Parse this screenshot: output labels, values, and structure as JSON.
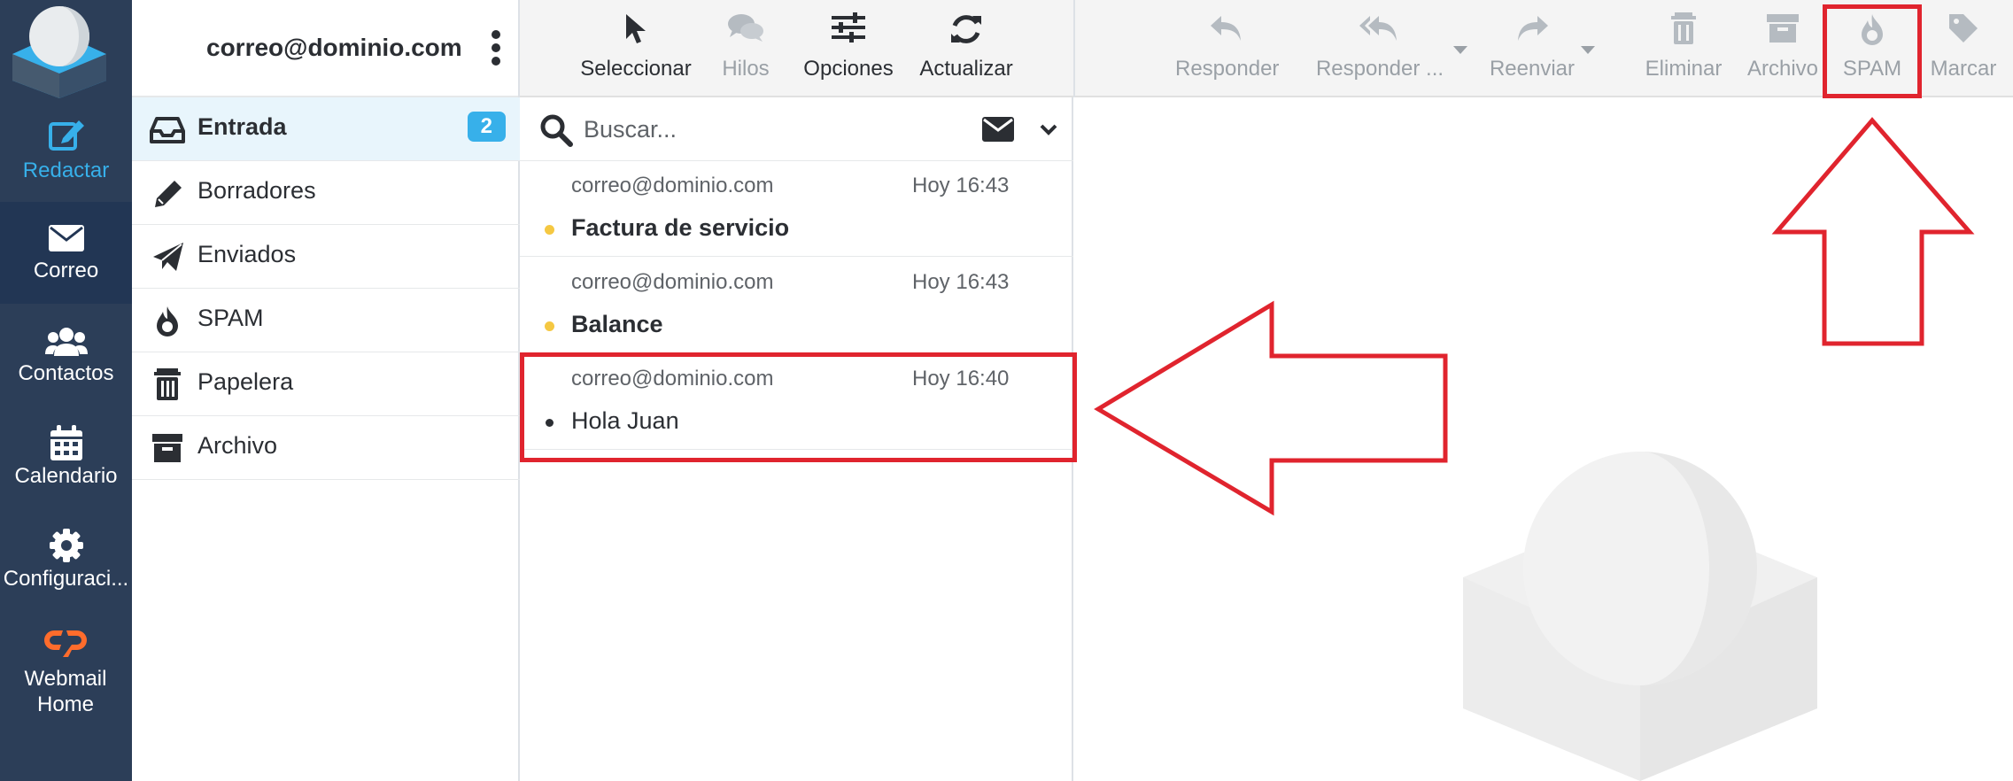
{
  "nav": [
    {
      "label": "Redactar",
      "icon": "compose-icon"
    },
    {
      "label": "Correo",
      "icon": "envelope-icon"
    },
    {
      "label": "Contactos",
      "icon": "users-icon"
    },
    {
      "label": "Calendario",
      "icon": "calendar-icon"
    },
    {
      "label": "Configuraci...",
      "icon": "gear-icon"
    },
    {
      "label": "Webmail Home",
      "icon": "cpanel-icon"
    }
  ],
  "account": "correo@dominio.com",
  "folders": [
    {
      "name": "Entrada",
      "icon": "inbox-icon",
      "badge": "2"
    },
    {
      "name": "Borradores",
      "icon": "pencil-icon"
    },
    {
      "name": "Enviados",
      "icon": "paper-plane-icon"
    },
    {
      "name": "SPAM",
      "icon": "fire-icon"
    },
    {
      "name": "Papelera",
      "icon": "trash-icon"
    },
    {
      "name": "Archivo",
      "icon": "archive-box-icon"
    }
  ],
  "toolbar": {
    "select": "Seleccionar",
    "threads": "Hilos",
    "options": "Opciones",
    "refresh": "Actualizar",
    "reply": "Responder",
    "reply_all": "Responder ...",
    "forward": "Reenviar",
    "delete": "Eliminar",
    "archive": "Archivo",
    "spam": "SPAM",
    "mark": "Marcar"
  },
  "search": {
    "placeholder": "Buscar..."
  },
  "messages": [
    {
      "from": "correo@dominio.com",
      "date": "Hoy 16:43",
      "subject": "Factura de servicio",
      "unread": true
    },
    {
      "from": "correo@dominio.com",
      "date": "Hoy 16:43",
      "subject": "Balance",
      "unread": true
    },
    {
      "from": "correo@dominio.com",
      "date": "Hoy 16:40",
      "subject": "Hola Juan",
      "unread": false
    }
  ],
  "colors": {
    "rail": "#2c3e58",
    "accent": "#37b0ea",
    "unread_dot": "#f5c842",
    "annotation": "#e0242e",
    "cpanel": "#ff6c2c"
  }
}
